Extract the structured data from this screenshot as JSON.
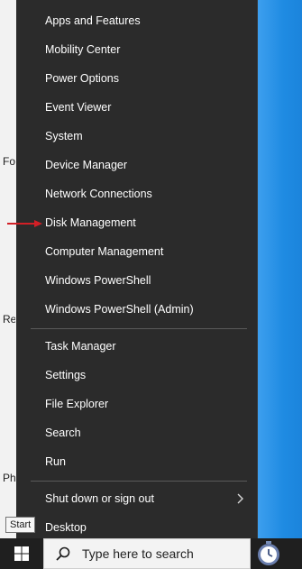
{
  "desktop": {
    "edge_labels": [
      "Fo",
      "Re",
      "Ph"
    ]
  },
  "menu": {
    "groups": [
      {
        "items": [
          {
            "label": "Apps and Features"
          },
          {
            "label": "Mobility Center"
          },
          {
            "label": "Power Options"
          },
          {
            "label": "Event Viewer"
          },
          {
            "label": "System"
          },
          {
            "label": "Device Manager"
          },
          {
            "label": "Network Connections"
          },
          {
            "label": "Disk Management"
          },
          {
            "label": "Computer Management"
          },
          {
            "label": "Windows PowerShell"
          },
          {
            "label": "Windows PowerShell (Admin)"
          }
        ]
      },
      {
        "items": [
          {
            "label": "Task Manager"
          },
          {
            "label": "Settings"
          },
          {
            "label": "File Explorer"
          },
          {
            "label": "Search"
          },
          {
            "label": "Run"
          }
        ]
      },
      {
        "items": [
          {
            "label": "Shut down or sign out",
            "submenu": true
          },
          {
            "label": "Desktop"
          }
        ]
      }
    ],
    "highlighted_item": "Disk Management",
    "pointer_color": "#d21f26"
  },
  "taskbar": {
    "tooltip": "Start",
    "search_placeholder": "Type here to search",
    "start_icon": "windows-logo-icon",
    "search_icon": "search-icon",
    "cortana_icon": "timer-clock-icon"
  },
  "colors": {
    "menu_bg": "#2b2b2b",
    "menu_text": "#ffffff",
    "separator": "#5a5a5a",
    "desktop_accent": "#1f86da",
    "taskbar_bg": "#1f1f1f"
  }
}
